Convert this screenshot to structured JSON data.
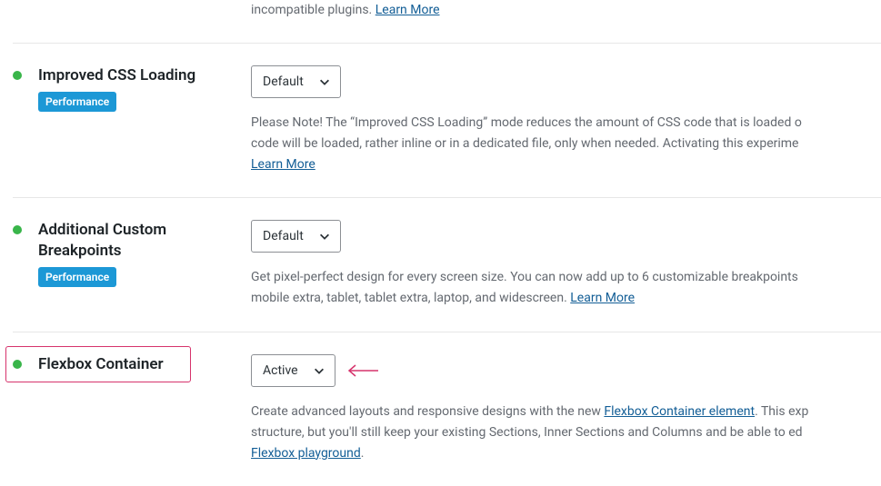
{
  "row0": {
    "desc_tail": "incompatible plugins.",
    "learn_more": "Learn More"
  },
  "row1": {
    "title": "Improved CSS Loading",
    "tag": "Performance",
    "select": "Default",
    "desc_line1": "Please Note! The “Improved CSS Loading” mode reduces the amount of CSS code that is loaded o",
    "desc_line2": "code will be loaded, rather inline or in a dedicated file, only when needed. Activating this experime",
    "learn_more": "Learn More"
  },
  "row2": {
    "title": "Additional Custom Breakpoints",
    "tag": "Performance",
    "select": "Default",
    "desc_line1": "Get pixel-perfect design for every screen size. You can now add up to 6 customizable breakpoints ",
    "desc_line2_a": "mobile extra, tablet, tablet extra, laptop, and widescreen. ",
    "learn_more": "Learn More"
  },
  "row3": {
    "title": "Flexbox Container",
    "select": "Active",
    "desc_line1_a": "Create advanced layouts and responsive designs with the new ",
    "link1": "Flexbox Container element",
    "desc_line1_b": ". This exp",
    "desc_line2": "structure, but you'll still keep your existing Sections, Inner Sections and Columns and be able to ed",
    "link2": "Flexbox playground",
    "desc_line3_b": "."
  }
}
